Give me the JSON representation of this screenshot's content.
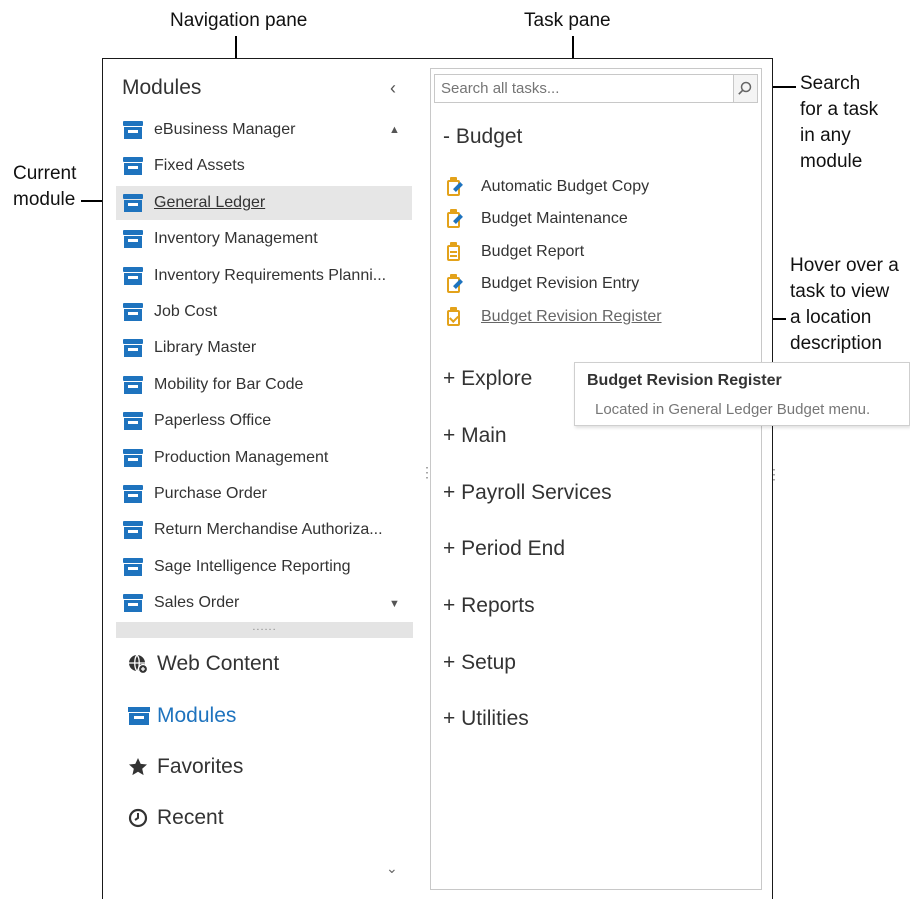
{
  "annotations": {
    "navigation_pane": "Navigation pane",
    "task_pane": "Task pane",
    "current_module": [
      "Current",
      "module"
    ],
    "search": [
      "Search",
      "for a task",
      "in any",
      "module"
    ],
    "hover": [
      "Hover over a",
      "task to view",
      "a location",
      "description"
    ]
  },
  "nav": {
    "title": "Modules",
    "collapse_icon": "chevron-left-icon",
    "modules": [
      {
        "label": "eBusiness Manager"
      },
      {
        "label": "Fixed Assets"
      },
      {
        "label": "General Ledger",
        "current": true
      },
      {
        "label": "Inventory Management"
      },
      {
        "label": "Inventory Requirements Planni..."
      },
      {
        "label": "Job Cost"
      },
      {
        "label": "Library Master"
      },
      {
        "label": "Mobility for Bar Code"
      },
      {
        "label": "Paperless Office"
      },
      {
        "label": "Production Management"
      },
      {
        "label": "Purchase Order"
      },
      {
        "label": "Return Merchandise Authoriza..."
      },
      {
        "label": "Sage Intelligence Reporting"
      },
      {
        "label": "Sales Order"
      }
    ],
    "splitter_glyph": "......",
    "groups": {
      "web_content": "Web Content",
      "modules": "Modules",
      "favorites": "Favorites",
      "recent": "Recent"
    }
  },
  "task_pane": {
    "search_placeholder": "Search all tasks...",
    "search_icon": "magnifier-icon",
    "budget_heading": "-  Budget",
    "budget_tasks": [
      "Automatic Budget Copy",
      "Budget Maintenance",
      "Budget Report",
      "Budget Revision Entry",
      "Budget Revision Register"
    ],
    "sections": [
      "+ Explore",
      "+ Main",
      "+ Payroll Services",
      "+ Period End",
      "+ Reports",
      "+ Setup",
      "+ Utilities"
    ]
  },
  "tooltip": {
    "title": "Budget Revision Register",
    "description": "Located in General Ledger Budget menu."
  },
  "colors": {
    "accent_blue": "#1e73be",
    "task_icon_gold": "#e3a21a",
    "current_row_bg": "#e6e6e6"
  }
}
